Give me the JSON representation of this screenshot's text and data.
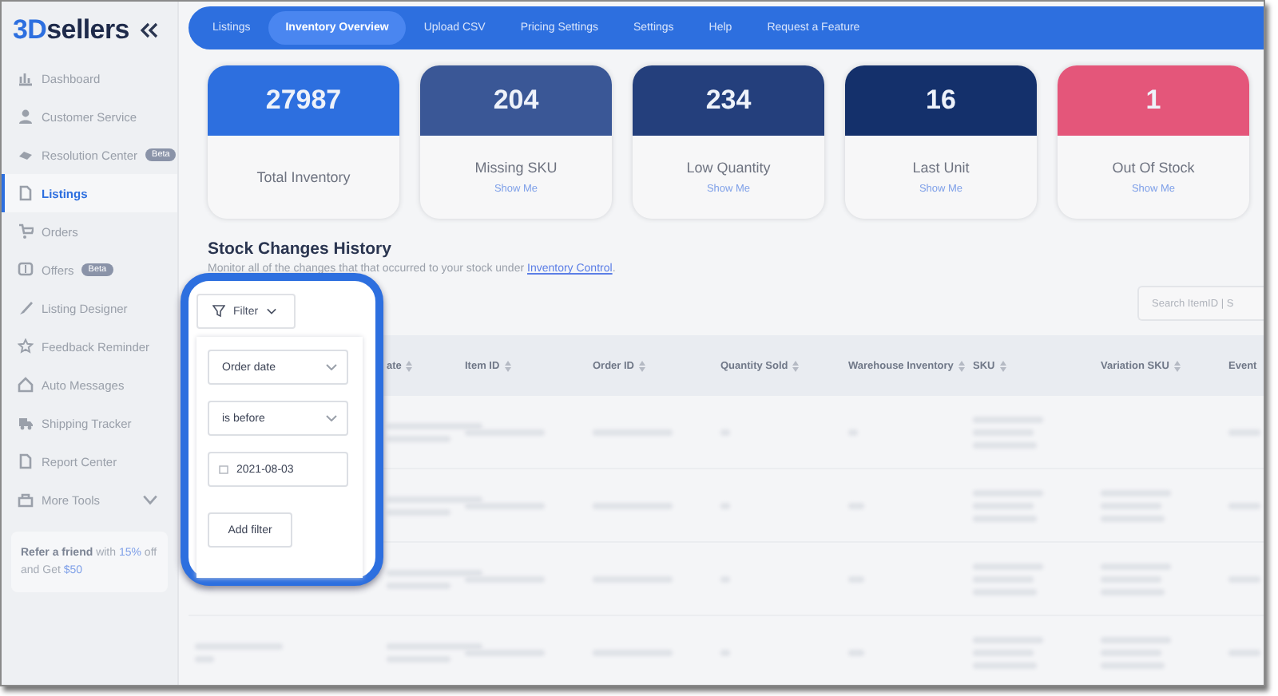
{
  "logo": {
    "accent": "3D",
    "rest": "sellers"
  },
  "sidebar": {
    "items": [
      {
        "label": "Dashboard",
        "selected": false
      },
      {
        "label": "Customer Service",
        "selected": false
      },
      {
        "label": "Resolution Center",
        "badge": "Beta",
        "selected": false
      },
      {
        "label": "Listings",
        "selected": true
      },
      {
        "label": "Orders",
        "selected": false
      },
      {
        "label": "Offers",
        "badge": "Beta",
        "selected": false
      },
      {
        "label": "Listing Designer",
        "selected": false
      },
      {
        "label": "Feedback Reminder",
        "selected": false
      },
      {
        "label": "Auto Messages",
        "selected": false
      },
      {
        "label": "Shipping Tracker",
        "selected": false
      },
      {
        "label": "Report Center",
        "selected": false
      },
      {
        "label": "More Tools",
        "selected": false
      }
    ],
    "promo": [
      {
        "text": "Refer a friend",
        "kind": "bold"
      },
      {
        "text": " with ",
        "kind": "plain"
      },
      {
        "text": "15%",
        "kind": "accent"
      },
      {
        "text": " off and Get ",
        "kind": "plain"
      },
      {
        "text": "$50",
        "kind": "accent"
      }
    ]
  },
  "tabs": [
    {
      "label": "Listings",
      "selected": false
    },
    {
      "label": "Inventory Overview",
      "selected": true
    },
    {
      "label": "Upload CSV",
      "selected": false
    },
    {
      "label": "Pricing Settings",
      "selected": false
    },
    {
      "label": "Settings",
      "selected": false
    },
    {
      "label": "Help",
      "selected": false
    },
    {
      "label": "Request a Feature",
      "selected": false
    }
  ],
  "cards": [
    {
      "value": "27987",
      "label": "Total Inventory",
      "color": "#2d6fdf"
    },
    {
      "value": "204",
      "label": "Missing SKU",
      "link": "Show Me",
      "color": "#3a5796"
    },
    {
      "value": "234",
      "label": "Low Quantity",
      "link": "Show Me",
      "color": "#243f7c"
    },
    {
      "value": "16",
      "label": "Last Unit",
      "link": "Show Me",
      "color": "#14306b"
    },
    {
      "value": "1",
      "label": "Out Of Stock",
      "link": "Show Me",
      "color": "#e4567a"
    }
  ],
  "section": {
    "title": "Stock Changes History",
    "subtitle": "Monitor all of the changes that that occurred to your stock under ",
    "link": "Inventory Control",
    "end": "."
  },
  "search": {
    "placeholder": "Search ItemID | S"
  },
  "table": {
    "columns": [
      {
        "label": "ate"
      },
      {
        "label": "Item ID"
      },
      {
        "label": "Order ID"
      },
      {
        "label": "Quantity Sold"
      },
      {
        "label": "Warehouse Inventory"
      },
      {
        "label": "SKU"
      },
      {
        "label": "Variation SKU"
      },
      {
        "label": "Event"
      }
    ]
  },
  "filter": {
    "button": "Filter",
    "field": "Order date",
    "operator": "is before",
    "date": "2021-08-03",
    "add": "Add filter"
  }
}
